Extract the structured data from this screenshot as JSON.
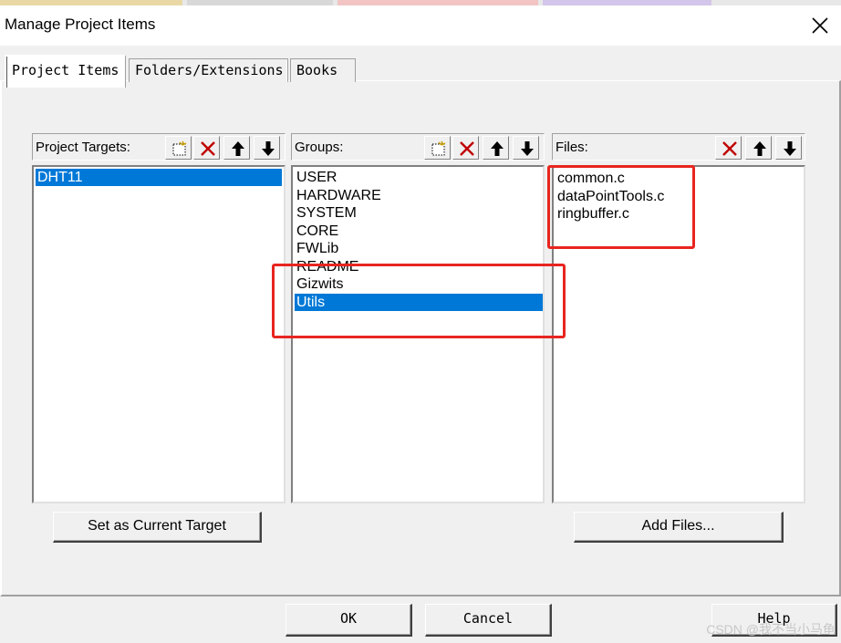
{
  "window": {
    "title": "Manage Project Items"
  },
  "tabs": [
    {
      "label": "Project Items",
      "active": true
    },
    {
      "label": "Folders/Extensions",
      "active": false
    },
    {
      "label": "Books",
      "active": false
    }
  ],
  "targets": {
    "label": "Project Targets:",
    "items": [
      "DHT11"
    ],
    "selected": "DHT11",
    "set_current_button": "Set as Current Target"
  },
  "groups": {
    "label": "Groups:",
    "items": [
      "USER",
      "HARDWARE",
      "SYSTEM",
      "CORE",
      "FWLib",
      "README",
      "Gizwits",
      "Utils"
    ],
    "selected": "Utils"
  },
  "files": {
    "label": "Files:",
    "items": [
      "common.c",
      "dataPointTools.c",
      "ringbuffer.c"
    ],
    "add_button": "Add Files..."
  },
  "footer": {
    "ok": "OK",
    "cancel": "Cancel",
    "help": "Help"
  },
  "watermark": "CSDN @我不当小马龟",
  "colors": {
    "selection": "#0078d7",
    "highlight_box": "#e8251f"
  },
  "icons": [
    "new-icon",
    "delete-icon",
    "move-up-icon",
    "move-down-icon",
    "close-icon"
  ]
}
